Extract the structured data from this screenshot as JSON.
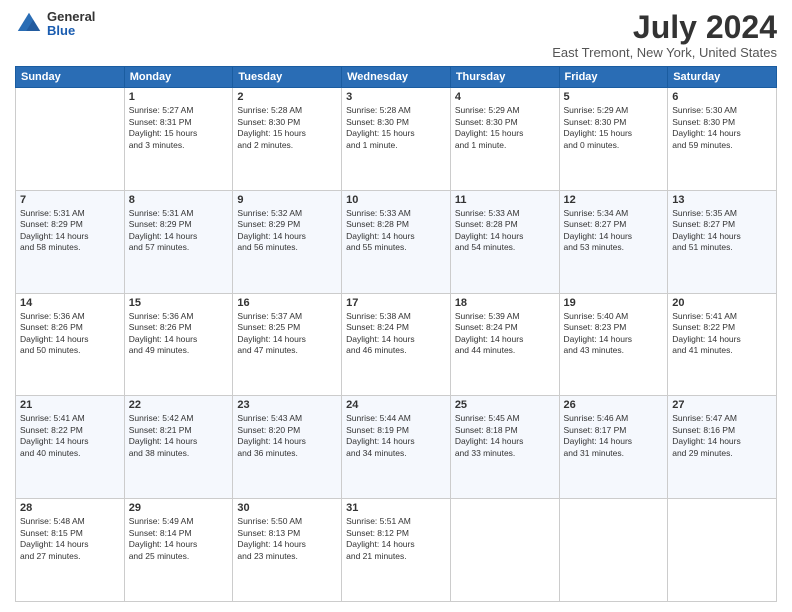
{
  "logo": {
    "general": "General",
    "blue": "Blue"
  },
  "title": "July 2024",
  "subtitle": "East Tremont, New York, United States",
  "days": [
    "Sunday",
    "Monday",
    "Tuesday",
    "Wednesday",
    "Thursday",
    "Friday",
    "Saturday"
  ],
  "weeks": [
    [
      {
        "day": "",
        "content": ""
      },
      {
        "day": "1",
        "content": "Sunrise: 5:27 AM\nSunset: 8:31 PM\nDaylight: 15 hours\nand 3 minutes."
      },
      {
        "day": "2",
        "content": "Sunrise: 5:28 AM\nSunset: 8:30 PM\nDaylight: 15 hours\nand 2 minutes."
      },
      {
        "day": "3",
        "content": "Sunrise: 5:28 AM\nSunset: 8:30 PM\nDaylight: 15 hours\nand 1 minute."
      },
      {
        "day": "4",
        "content": "Sunrise: 5:29 AM\nSunset: 8:30 PM\nDaylight: 15 hours\nand 1 minute."
      },
      {
        "day": "5",
        "content": "Sunrise: 5:29 AM\nSunset: 8:30 PM\nDaylight: 15 hours\nand 0 minutes."
      },
      {
        "day": "6",
        "content": "Sunrise: 5:30 AM\nSunset: 8:30 PM\nDaylight: 14 hours\nand 59 minutes."
      }
    ],
    [
      {
        "day": "7",
        "content": "Sunrise: 5:31 AM\nSunset: 8:29 PM\nDaylight: 14 hours\nand 58 minutes."
      },
      {
        "day": "8",
        "content": "Sunrise: 5:31 AM\nSunset: 8:29 PM\nDaylight: 14 hours\nand 57 minutes."
      },
      {
        "day": "9",
        "content": "Sunrise: 5:32 AM\nSunset: 8:29 PM\nDaylight: 14 hours\nand 56 minutes."
      },
      {
        "day": "10",
        "content": "Sunrise: 5:33 AM\nSunset: 8:28 PM\nDaylight: 14 hours\nand 55 minutes."
      },
      {
        "day": "11",
        "content": "Sunrise: 5:33 AM\nSunset: 8:28 PM\nDaylight: 14 hours\nand 54 minutes."
      },
      {
        "day": "12",
        "content": "Sunrise: 5:34 AM\nSunset: 8:27 PM\nDaylight: 14 hours\nand 53 minutes."
      },
      {
        "day": "13",
        "content": "Sunrise: 5:35 AM\nSunset: 8:27 PM\nDaylight: 14 hours\nand 51 minutes."
      }
    ],
    [
      {
        "day": "14",
        "content": "Sunrise: 5:36 AM\nSunset: 8:26 PM\nDaylight: 14 hours\nand 50 minutes."
      },
      {
        "day": "15",
        "content": "Sunrise: 5:36 AM\nSunset: 8:26 PM\nDaylight: 14 hours\nand 49 minutes."
      },
      {
        "day": "16",
        "content": "Sunrise: 5:37 AM\nSunset: 8:25 PM\nDaylight: 14 hours\nand 47 minutes."
      },
      {
        "day": "17",
        "content": "Sunrise: 5:38 AM\nSunset: 8:24 PM\nDaylight: 14 hours\nand 46 minutes."
      },
      {
        "day": "18",
        "content": "Sunrise: 5:39 AM\nSunset: 8:24 PM\nDaylight: 14 hours\nand 44 minutes."
      },
      {
        "day": "19",
        "content": "Sunrise: 5:40 AM\nSunset: 8:23 PM\nDaylight: 14 hours\nand 43 minutes."
      },
      {
        "day": "20",
        "content": "Sunrise: 5:41 AM\nSunset: 8:22 PM\nDaylight: 14 hours\nand 41 minutes."
      }
    ],
    [
      {
        "day": "21",
        "content": "Sunrise: 5:41 AM\nSunset: 8:22 PM\nDaylight: 14 hours\nand 40 minutes."
      },
      {
        "day": "22",
        "content": "Sunrise: 5:42 AM\nSunset: 8:21 PM\nDaylight: 14 hours\nand 38 minutes."
      },
      {
        "day": "23",
        "content": "Sunrise: 5:43 AM\nSunset: 8:20 PM\nDaylight: 14 hours\nand 36 minutes."
      },
      {
        "day": "24",
        "content": "Sunrise: 5:44 AM\nSunset: 8:19 PM\nDaylight: 14 hours\nand 34 minutes."
      },
      {
        "day": "25",
        "content": "Sunrise: 5:45 AM\nSunset: 8:18 PM\nDaylight: 14 hours\nand 33 minutes."
      },
      {
        "day": "26",
        "content": "Sunrise: 5:46 AM\nSunset: 8:17 PM\nDaylight: 14 hours\nand 31 minutes."
      },
      {
        "day": "27",
        "content": "Sunrise: 5:47 AM\nSunset: 8:16 PM\nDaylight: 14 hours\nand 29 minutes."
      }
    ],
    [
      {
        "day": "28",
        "content": "Sunrise: 5:48 AM\nSunset: 8:15 PM\nDaylight: 14 hours\nand 27 minutes."
      },
      {
        "day": "29",
        "content": "Sunrise: 5:49 AM\nSunset: 8:14 PM\nDaylight: 14 hours\nand 25 minutes."
      },
      {
        "day": "30",
        "content": "Sunrise: 5:50 AM\nSunset: 8:13 PM\nDaylight: 14 hours\nand 23 minutes."
      },
      {
        "day": "31",
        "content": "Sunrise: 5:51 AM\nSunset: 8:12 PM\nDaylight: 14 hours\nand 21 minutes."
      },
      {
        "day": "",
        "content": ""
      },
      {
        "day": "",
        "content": ""
      },
      {
        "day": "",
        "content": ""
      }
    ]
  ]
}
